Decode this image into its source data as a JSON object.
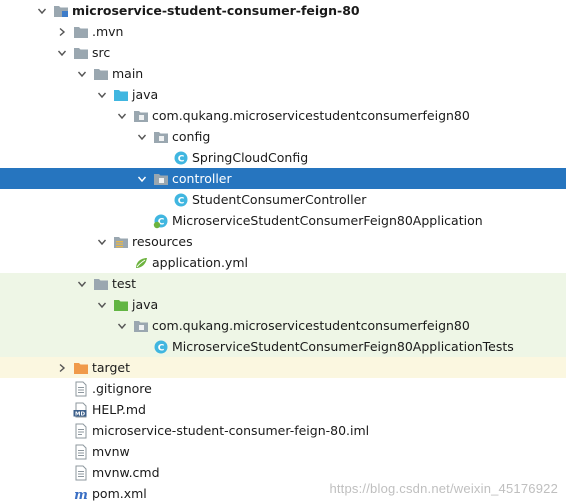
{
  "tree": [
    {
      "label": "microservice-student-consumer-feign-80",
      "depth": 0,
      "expanded": true,
      "icon": "module-folder-icon",
      "bold": true,
      "style": "normal"
    },
    {
      "label": ".mvn",
      "depth": 1,
      "expanded": false,
      "icon": "folder-icon",
      "style": "normal"
    },
    {
      "label": "src",
      "depth": 1,
      "expanded": true,
      "icon": "folder-icon",
      "style": "normal"
    },
    {
      "label": "main",
      "depth": 2,
      "expanded": true,
      "icon": "folder-icon",
      "style": "normal"
    },
    {
      "label": "java",
      "depth": 3,
      "expanded": true,
      "icon": "source-folder-icon",
      "style": "normal"
    },
    {
      "label": "com.qukang.microservicestudentconsumerfeign80",
      "depth": 4,
      "expanded": true,
      "icon": "package-icon",
      "style": "normal"
    },
    {
      "label": "config",
      "depth": 5,
      "expanded": true,
      "icon": "package-icon",
      "style": "normal"
    },
    {
      "label": "SpringCloudConfig",
      "depth": 6,
      "icon": "class-icon",
      "style": "normal"
    },
    {
      "label": "controller",
      "depth": 5,
      "expanded": true,
      "icon": "package-icon",
      "style": "selected"
    },
    {
      "label": "StudentConsumerController",
      "depth": 6,
      "icon": "class-icon",
      "style": "normal"
    },
    {
      "label": "MicroserviceStudentConsumerFeign80Application",
      "depth": 5,
      "icon": "spring-app-class-icon",
      "style": "normal"
    },
    {
      "label": "resources",
      "depth": 3,
      "expanded": true,
      "icon": "resources-folder-icon",
      "style": "normal"
    },
    {
      "label": "application.yml",
      "depth": 4,
      "icon": "yml-file-icon",
      "style": "normal"
    },
    {
      "label": "test",
      "depth": 2,
      "expanded": true,
      "icon": "folder-icon",
      "style": "test"
    },
    {
      "label": "java",
      "depth": 3,
      "expanded": true,
      "icon": "test-source-folder-icon",
      "style": "test"
    },
    {
      "label": "com.qukang.microservicestudentconsumerfeign80",
      "depth": 4,
      "expanded": true,
      "icon": "package-icon",
      "style": "test"
    },
    {
      "label": "MicroserviceStudentConsumerFeign80ApplicationTests",
      "depth": 5,
      "icon": "class-icon",
      "style": "test"
    },
    {
      "label": "target",
      "depth": 1,
      "expanded": false,
      "icon": "excluded-folder-icon",
      "style": "excluded"
    },
    {
      "label": ".gitignore",
      "depth": 1,
      "icon": "text-file-icon",
      "style": "normal"
    },
    {
      "label": "HELP.md",
      "depth": 1,
      "icon": "markdown-file-icon",
      "style": "normal"
    },
    {
      "label": "microservice-student-consumer-feign-80.iml",
      "depth": 1,
      "icon": "iml-file-icon",
      "style": "normal"
    },
    {
      "label": "mvnw",
      "depth": 1,
      "icon": "text-file-icon",
      "style": "normal"
    },
    {
      "label": "mvnw.cmd",
      "depth": 1,
      "icon": "text-file-icon",
      "style": "normal"
    },
    {
      "label": "pom.xml",
      "depth": 1,
      "icon": "maven-pom-icon",
      "style": "normal"
    }
  ],
  "watermark": "https://blog.csdn.net/weixin_45176922",
  "colors": {
    "selection": "#2675bf",
    "test_row": "#eef6e6",
    "excluded_row": "#fbf7e0",
    "folder": "#9aa7b0",
    "source_folder": "#40b6e0",
    "test_folder": "#62b543",
    "excluded_folder": "#f09a4a",
    "class": "#40b6e0"
  }
}
